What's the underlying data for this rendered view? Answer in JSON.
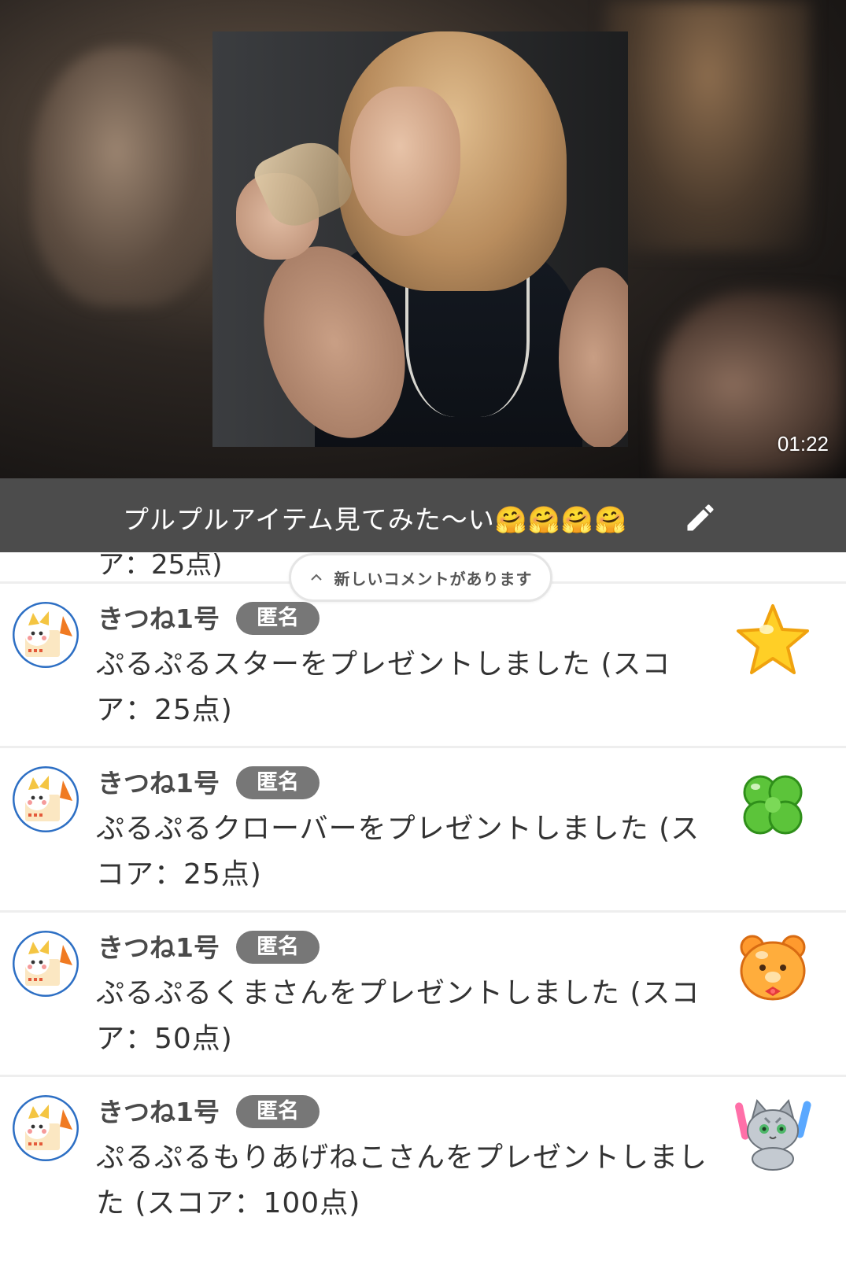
{
  "video": {
    "timestamp": "01:22"
  },
  "caption": {
    "text": "プルプルアイテム見てみた〜い🤗🤗🤗🤗",
    "edit_icon": "pencil-icon"
  },
  "comments": {
    "partial_previous_text": "ア：25点)",
    "new_comments_label": "新しいコメントがあります",
    "items": [
      {
        "name": "きつね1号",
        "badge": "匿名",
        "message": "ぷるぷるスターをプレゼントしました (スコア：25点)",
        "item_icon": "star-icon",
        "item_color": "#ffcc22"
      },
      {
        "name": "きつね1号",
        "badge": "匿名",
        "message": "ぷるぷるクローバーをプレゼントしました (スコア：25点)",
        "item_icon": "clover-icon",
        "item_color": "#5cc43a"
      },
      {
        "name": "きつね1号",
        "badge": "匿名",
        "message": "ぷるぷるくまさんをプレゼントしました (スコア：50点)",
        "item_icon": "bear-icon",
        "item_color": "#ff9a2e"
      },
      {
        "name": "きつね1号",
        "badge": "匿名",
        "message": "ぷるぷるもりあげねこさんをプレゼントしました (スコア：100点)",
        "item_icon": "cat-icon",
        "item_color": "#9aa3ad"
      }
    ]
  },
  "colors": {
    "caption_bar": "#4c4c4c",
    "badge": "#777777",
    "avatar_ring": "#2d6fc4",
    "avatar_fox": "#f07a22"
  }
}
